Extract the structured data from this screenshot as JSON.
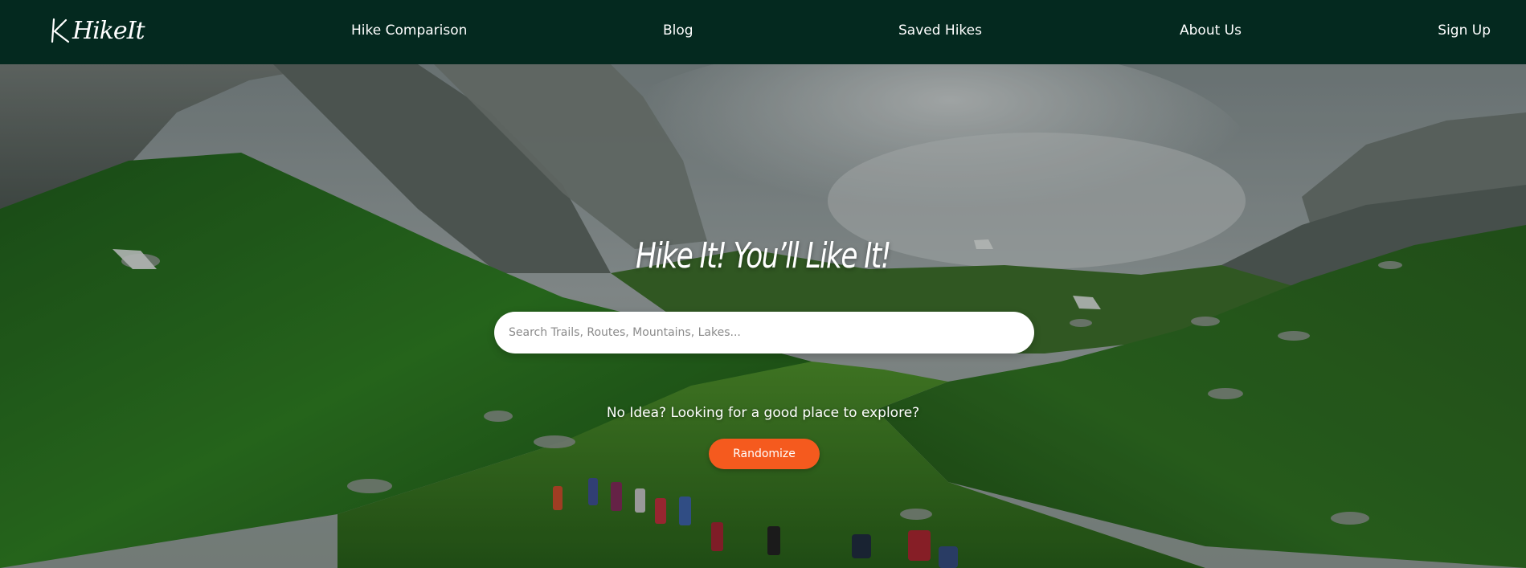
{
  "header": {
    "logo_text": "HikeIt",
    "logo_icon": "hiker-k-icon",
    "nav": [
      {
        "label": "Hike Comparison"
      },
      {
        "label": "Blog"
      },
      {
        "label": "Saved Hikes"
      },
      {
        "label": "About Us"
      },
      {
        "label": "Sign Up"
      }
    ],
    "colors": {
      "background": "#04291f",
      "text": "#ffffff"
    }
  },
  "hero": {
    "title": "Hike It! You’ll Like It!",
    "search": {
      "placeholder": "Search Trails, Routes, Mountains, Lakes...",
      "value": ""
    },
    "prompt": "No Idea? Looking for a good place to explore?",
    "randomize_label": "Randomize",
    "background_image": "mountain-valley-hikers-photo",
    "colors": {
      "button": "#f55a1e",
      "button_text": "#ffffff"
    }
  }
}
